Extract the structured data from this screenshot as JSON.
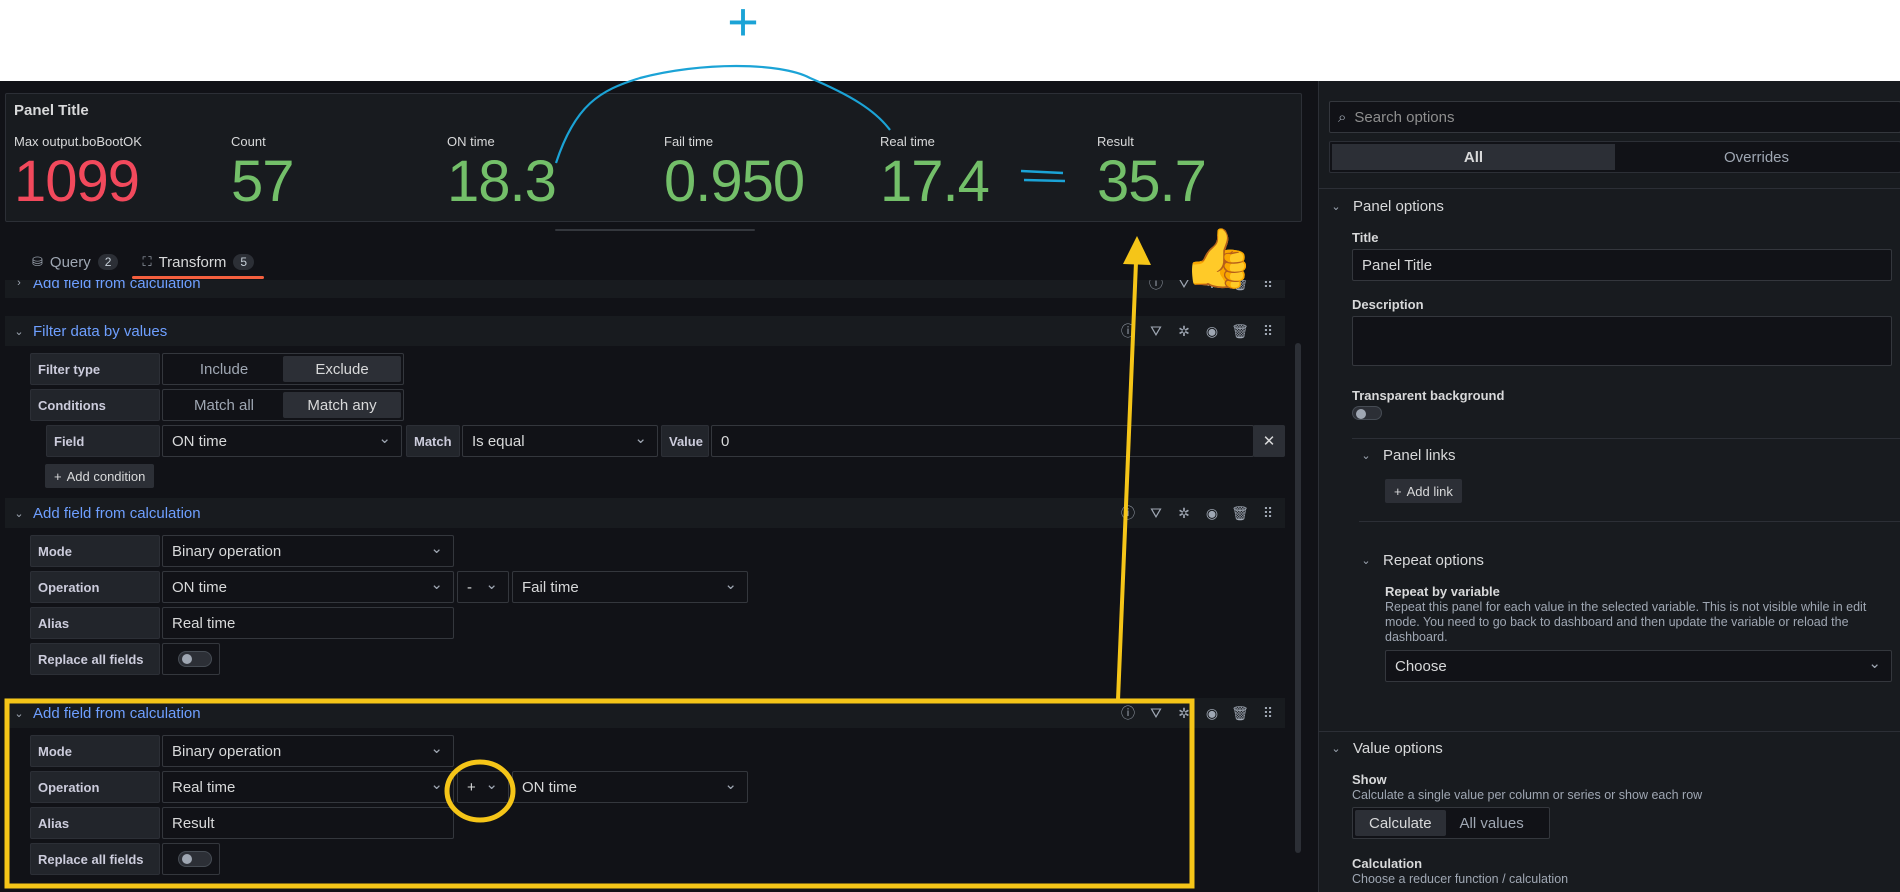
{
  "panel": {
    "title": "Panel Title",
    "stats": [
      {
        "label": "Max output.boBootOK",
        "value": "1099",
        "color": "#f2495c"
      },
      {
        "label": "Count",
        "value": "57",
        "color": "#73bf69"
      },
      {
        "label": "ON time",
        "value": "18.3",
        "color": "#73bf69"
      },
      {
        "label": "Fail time",
        "value": "0.950",
        "color": "#73bf69"
      },
      {
        "label": "Real time",
        "value": "17.4",
        "color": "#73bf69"
      },
      {
        "label": "Result",
        "value": "35.7",
        "color": "#73bf69"
      }
    ]
  },
  "tabs": [
    {
      "label": "Query",
      "count": "2",
      "icon": "database-icon"
    },
    {
      "label": "Transform",
      "count": "5",
      "icon": "transform-icon",
      "active": true
    }
  ],
  "transforms": {
    "t1": {
      "title": "Add field from calculation"
    },
    "t2": {
      "title": "Filter data by values",
      "filter_type_label": "Filter type",
      "filter_type_options": [
        "Include",
        "Exclude"
      ],
      "conditions_label": "Conditions",
      "conditions_options": [
        "Match all",
        "Match any"
      ],
      "field_label": "Field",
      "field_value": "ON time",
      "match_label": "Match",
      "match_value": "Is equal",
      "value_label": "Value",
      "value_value": "0",
      "add_condition": "Add condition"
    },
    "t3": {
      "title": "Add field from calculation",
      "mode_label": "Mode",
      "mode_value": "Binary operation",
      "operation_label": "Operation",
      "op_left": "ON time",
      "op_operator": "-",
      "op_right": "Fail time",
      "alias_label": "Alias",
      "alias_value": "Real time",
      "replace_label": "Replace all fields"
    },
    "t4": {
      "title": "Add field from calculation",
      "mode_label": "Mode",
      "mode_value": "Binary operation",
      "operation_label": "Operation",
      "op_left": "Real time",
      "op_operator": "+",
      "op_right": "ON time",
      "alias_label": "Alias",
      "alias_value": "Result",
      "replace_label": "Replace all fields"
    }
  },
  "options": {
    "search_placeholder": "Search options",
    "seg_all": "All",
    "seg_overrides": "Overrides",
    "panel_options": "Panel options",
    "title_label": "Title",
    "title_value": "Panel Title",
    "description_label": "Description",
    "transparent_label": "Transparent background",
    "panel_links": "Panel links",
    "add_link": "Add link",
    "repeat_options": "Repeat options",
    "repeat_by_label": "Repeat by variable",
    "repeat_desc": "Repeat this panel for each value in the selected variable. This is not visible while in edit mode. You need to go back to dashboard and then update the variable or reload the dashboard.",
    "choose": "Choose",
    "value_options": "Value options",
    "show_label": "Show",
    "show_desc": "Calculate a single value per column or series or show each row",
    "show_calculate": "Calculate",
    "show_all_values": "All values",
    "calculation_label": "Calculation",
    "calculation_desc": "Choose a reducer function / calculation"
  },
  "annotations": {
    "plus_sign": "+",
    "equals_sign": "=",
    "thumbs_up": "👍",
    "highlight_color": "#f5c518",
    "ink_color": "#1ba3d6"
  }
}
